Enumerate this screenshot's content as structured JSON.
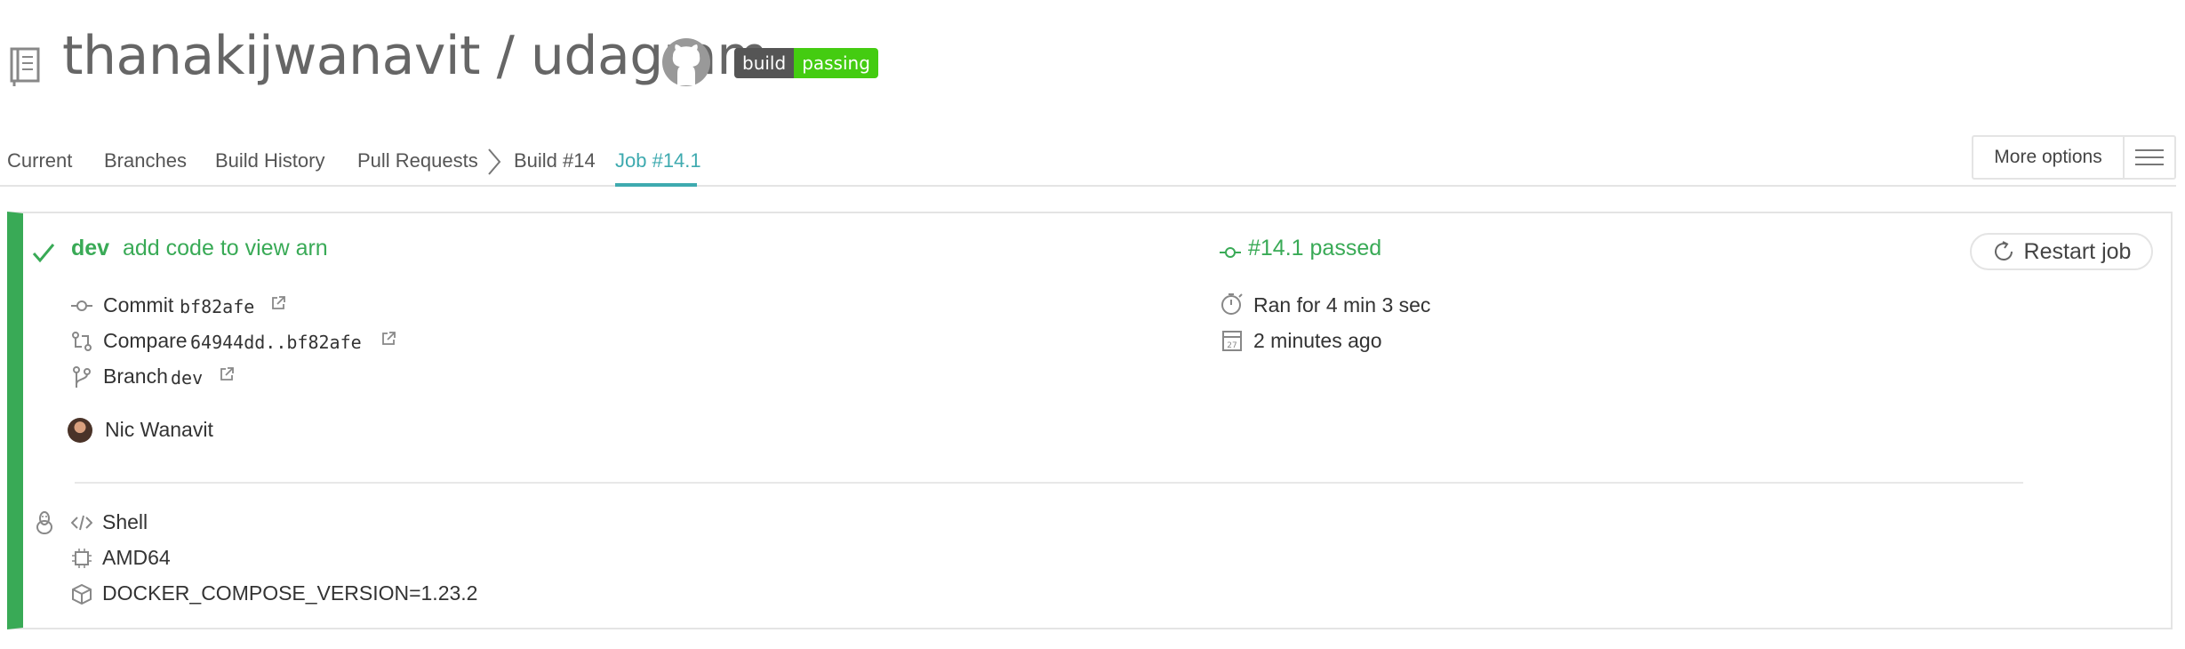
{
  "header": {
    "repo_title": "thanakijwanavit / udagram",
    "badge_left": "build",
    "badge_right": "passing"
  },
  "tabs": [
    {
      "label": "Current"
    },
    {
      "label": "Branches"
    },
    {
      "label": "Build History"
    },
    {
      "label": "Pull Requests"
    },
    {
      "label": "Build #14"
    },
    {
      "label": "Job #14.1"
    }
  ],
  "more_options": {
    "label": "More options"
  },
  "job": {
    "branch": "dev",
    "message": "add code to view arn",
    "status": "#14.1 passed",
    "restart_label": "Restart job",
    "commit_label": "Commit",
    "commit_sha": "bf82afe",
    "compare_label": "Compare",
    "compare_range": "64944dd..bf82afe",
    "branch_label": "Branch",
    "branch_name": "dev",
    "duration": "Ran for 4 min 3 sec",
    "finished": "2 minutes ago",
    "author": "Nic Wanavit",
    "language": "Shell",
    "arch": "AMD64",
    "env": "DOCKER_COMPOSE_VERSION=1.23.2"
  },
  "colors": {
    "passed": "#39aa56",
    "active_tab": "#3eaaaf"
  }
}
